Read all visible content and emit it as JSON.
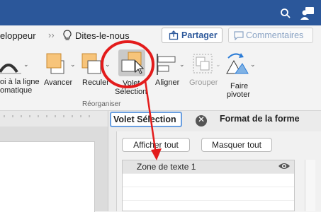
{
  "ribbon_tabs": {
    "developer": "eloppeur",
    "tell_me": "Dites-le-nous"
  },
  "share": {
    "label": "Partager"
  },
  "comments": {
    "label": "Commentaires"
  },
  "ribbon": {
    "wrap_text_line1": "oi à la ligne",
    "wrap_text_line2": "omatique",
    "bring_forward": "Avancer",
    "send_backward": "Reculer",
    "selection_pane_line1": "Volet",
    "selection_pane_line2": "Sélection",
    "align": "Aligner",
    "group": "Grouper",
    "rotate_line1": "Faire",
    "rotate_line2": "pivoter",
    "group_label": "Réorganiser"
  },
  "pane": {
    "tab_selection": "Volet Sélection",
    "tab_format": "Format de la forme",
    "show_all": "Afficher tout",
    "hide_all": "Masquer tout",
    "items": [
      {
        "label": "Zone de texte 1"
      }
    ]
  },
  "colors": {
    "title_bar": "#2b579a",
    "accent": "#2b579a",
    "annotation": "#e31b1b",
    "shape_fill": "#f7c47a"
  }
}
